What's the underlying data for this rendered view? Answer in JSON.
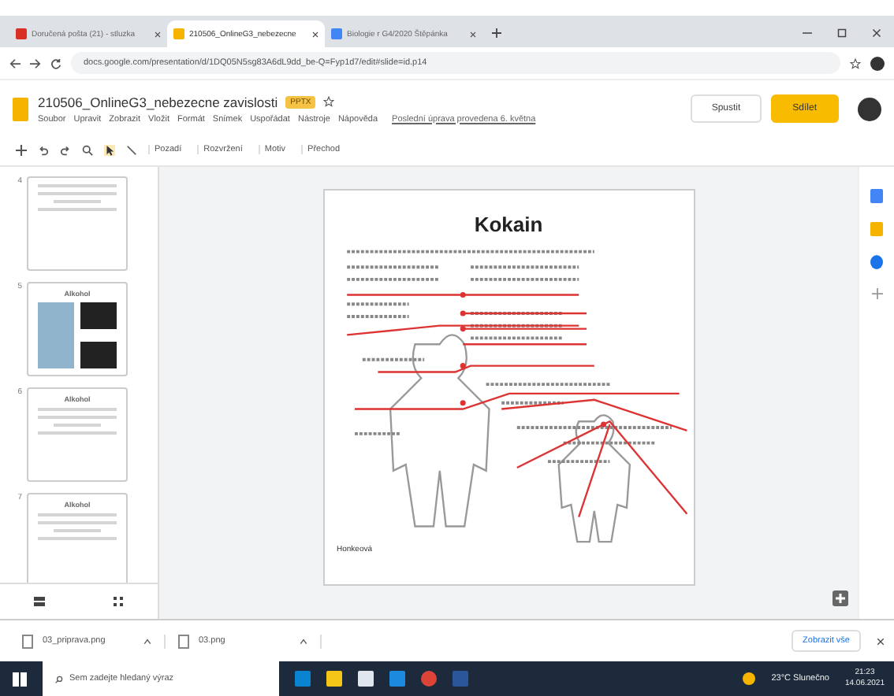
{
  "browser_tabs": [
    {
      "title": "Doručená pošta (21) - stluzka",
      "selected": false
    },
    {
      "title": "210506_OnlineG3_nebezecne",
      "selected": true
    },
    {
      "title": "Biologie r G4/2020 Štěpánka",
      "selected": false
    }
  ],
  "address_bar": {
    "url": "docs.google.com/presentation/d/1DQ05N5sg83A6dL9dd_be-Q=Fyp1d7/edit#slide=id.p14"
  },
  "document": {
    "title": "210506_OnlineG3_nebezecne zavislosti",
    "badge": "PPTX",
    "menus": [
      "Soubor",
      "Upravit",
      "Zobrazit",
      "Vložit",
      "Formát",
      "Snímek",
      "Uspořádat",
      "Nástroje",
      "Nápověda"
    ],
    "last_edit": "Poslední úprava provedena 6. května",
    "present_button": "Spustit",
    "share_button": "Sdílet"
  },
  "toolbar": {
    "text_buttons": [
      "Pozadí",
      "Rozvržení",
      "Motiv",
      "Přechod"
    ]
  },
  "filmstrip": [
    {
      "number": "4",
      "kind": "text"
    },
    {
      "number": "5",
      "kind": "pictures",
      "title": "Alkohol"
    },
    {
      "number": "6",
      "kind": "text",
      "title": "Alkohol"
    },
    {
      "number": "7",
      "kind": "text",
      "title": "Alkohol"
    }
  ],
  "slide": {
    "title": "Kokain",
    "author": "Honkeová"
  },
  "downloads": {
    "files": [
      "03_priprava.png",
      "03.png"
    ],
    "show_all": "Zobrazit vše"
  },
  "taskbar": {
    "search_placeholder": "Sem zadejte hledaný výraz",
    "weather": "23°C  Slunečno",
    "time": "21:23",
    "date": "14.06.2021"
  }
}
